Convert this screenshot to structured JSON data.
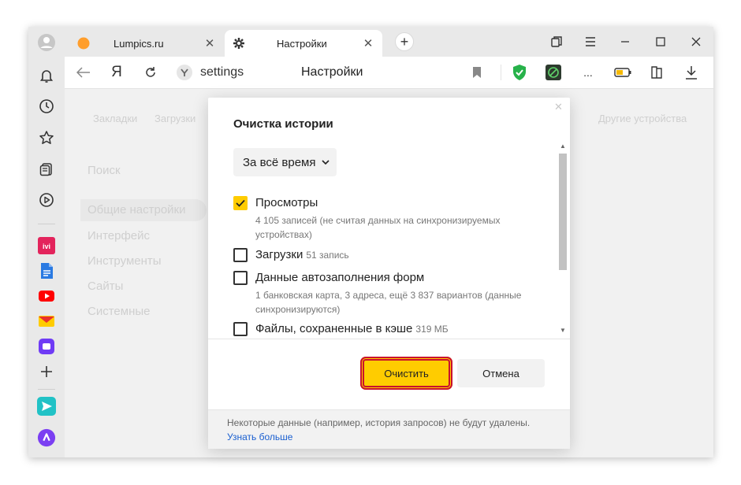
{
  "browser": {
    "tabs": [
      {
        "title": "Lumpics.ru",
        "favicon": "orange-circle-icon",
        "active": false
      },
      {
        "title": "Настройки",
        "favicon": "gear-icon",
        "active": true
      }
    ],
    "address": {
      "url": "settings",
      "page_title": "Настройки"
    }
  },
  "settings_page": {
    "top_nav": [
      "Закладки",
      "Загрузки",
      "Другие устройства"
    ],
    "search_placeholder": "Поиск",
    "side_nav": [
      "Общие настройки",
      "Интерфейс",
      "Инструменты",
      "Сайты",
      "Системные"
    ]
  },
  "dialog": {
    "title": "Очистка истории",
    "period": "За всё время",
    "items": [
      {
        "label": "Просмотры",
        "count": "",
        "checked": true,
        "desc": "4 105 записей (не считая данных на синхронизируемых устройствах)"
      },
      {
        "label": "Загрузки",
        "count": "51 запись",
        "checked": false,
        "desc": ""
      },
      {
        "label": "Данные автозаполнения форм",
        "count": "",
        "checked": false,
        "desc": "1 банковская карта, 3 адреса, ещё 3 837 вариантов (данные синхронизируются)"
      },
      {
        "label": "Файлы, сохраненные в кэше",
        "count": "319 МБ",
        "checked": false,
        "desc": ""
      }
    ],
    "clear_button": "Очистить",
    "cancel_button": "Отмена",
    "note": "Некоторые данные (например, история запросов) не будут удалены.",
    "learn_more": "Узнать больше"
  },
  "colors": {
    "accent_yellow": "#ffcc00",
    "highlight_red": "#c8102e",
    "link_blue": "#1a5fd0"
  }
}
